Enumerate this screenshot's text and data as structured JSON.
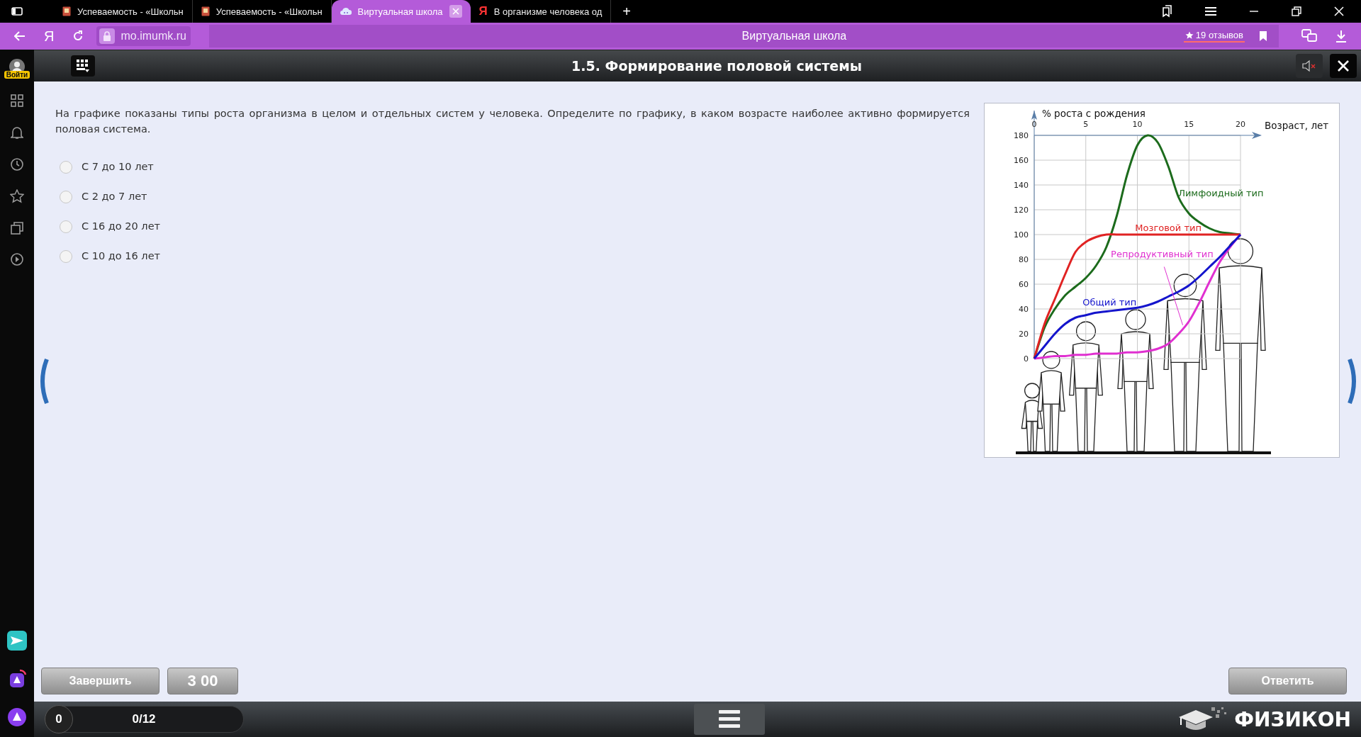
{
  "browser": {
    "tabs": [
      {
        "kind": "book",
        "title": "Успеваемость - «Школьн",
        "selected": false
      },
      {
        "kind": "book",
        "title": "Успеваемость - «Школьн",
        "selected": false
      },
      {
        "kind": "cloud",
        "title": "Виртуальная школа",
        "selected": true
      },
      {
        "kind": "letter",
        "favicon_letter": "Я",
        "title": "В организме человека од",
        "selected": false
      }
    ],
    "new_tab": "+",
    "logo_letter": "Я",
    "address": "mo.imumk.ru",
    "page_title": "Виртуальная школа",
    "reviews": "19 отзывов"
  },
  "sidebar": {
    "login": "Войти"
  },
  "lesson": {
    "title": "1.5. Формирование половой системы",
    "question": "На графике показаны типы роста организма в целом и отдельных систем у человека. Определите по графику, в каком возрасте наиболее активно формируется половая система.",
    "options": [
      {
        "label": "С 7 до 10 лет",
        "selected": false
      },
      {
        "label": "С 2 до 7 лет",
        "selected": false
      },
      {
        "label": "С 16 до 20 лет",
        "selected": false
      },
      {
        "label": "С 10 до 16 лет",
        "selected": false
      }
    ],
    "chart_data": {
      "type": "line",
      "xlabel": "Возраст, лет",
      "ylabel": "% роста с рождения",
      "x": [
        0,
        1,
        2,
        3,
        4,
        5,
        6,
        7,
        8,
        9,
        10,
        11,
        12,
        13,
        14,
        15,
        16,
        17,
        18,
        19,
        20
      ],
      "series": [
        {
          "name": "Лимфоидный тип",
          "color": "#1c6b1c",
          "values": [
            0,
            25,
            40,
            51,
            58,
            65,
            75,
            90,
            115,
            148,
            172,
            180,
            174,
            155,
            130,
            117,
            110,
            105,
            102,
            101,
            100
          ]
        },
        {
          "name": "Мозговой тип",
          "color": "#e02222",
          "values": [
            0,
            28,
            48,
            68,
            86,
            94,
            98,
            100,
            100,
            100,
            100,
            100,
            100,
            100,
            100,
            100,
            100,
            100,
            100,
            100,
            100
          ]
        },
        {
          "name": "Репродуктивный тип",
          "color": "#e030d0",
          "values": [
            0,
            1,
            2,
            2,
            3,
            3,
            4,
            4,
            4,
            5,
            5,
            6,
            8,
            12,
            20,
            30,
            45,
            62,
            78,
            90,
            100
          ]
        },
        {
          "name": "Общий тип",
          "color": "#1414cc",
          "values": [
            0,
            10,
            20,
            28,
            33,
            35,
            37,
            38,
            39,
            40,
            41,
            43,
            46,
            50,
            54,
            59,
            66,
            74,
            82,
            91,
            100
          ]
        }
      ],
      "grid": true,
      "xlim": [
        0,
        20
      ],
      "ylim": [
        0,
        200
      ],
      "xticks": [
        0,
        5,
        10,
        15,
        20
      ],
      "yticks": [
        0,
        20,
        40,
        60,
        80,
        100,
        120,
        140,
        160,
        180
      ]
    }
  },
  "footer": {
    "finish": "Завершить",
    "timer": "3 00",
    "answer": "Ответить",
    "score": "0",
    "progress": "0/12",
    "level": 0,
    "brand": "ФИЗИКОН"
  }
}
